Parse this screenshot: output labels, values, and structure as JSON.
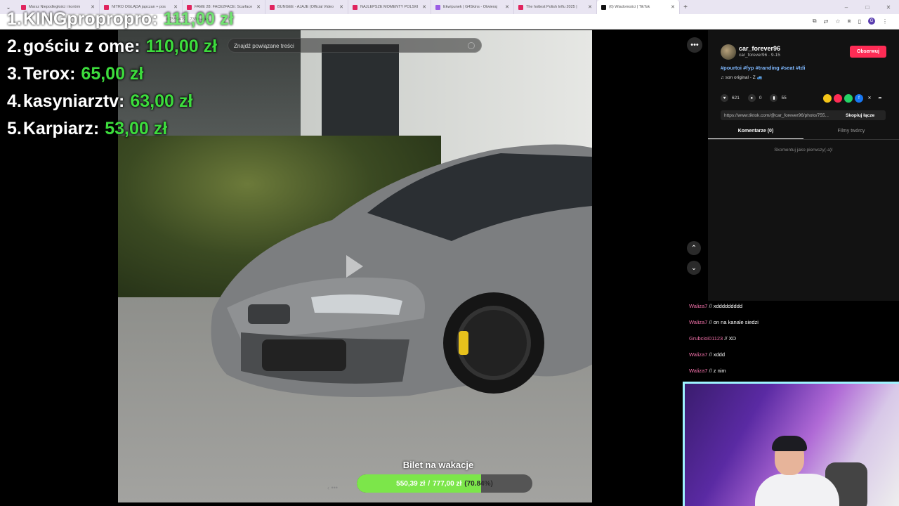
{
  "browser": {
    "tabs": [
      {
        "label": "Marsz Niepodległości i kontrm",
        "color": "#e0245e"
      },
      {
        "label": "NITRO OGLĄDA japczan + pos",
        "color": "#e0245e"
      },
      {
        "label": "FAME 28: FACE2FACE: Scarface",
        "color": "#e0245e"
      },
      {
        "label": "BUNGEE - AJAJE (Official Video",
        "color": "#e0245e"
      },
      {
        "label": "NAJLEPSZE MOMENTY POLSKI",
        "color": "#e0245e"
      },
      {
        "label": "Ekwipunek | G4Skins - Otwieraj",
        "color": "#9b5de5"
      },
      {
        "label": "The hottest Polish Influ 2025 |",
        "color": "#e0245e"
      },
      {
        "label": "(6) Wiadomości | TikTok",
        "color": "#111111"
      }
    ],
    "url_fragment": "d/7559479…73/images"
  },
  "leaderboard": [
    {
      "rank": "1.",
      "name": "KINGpropropro:",
      "amount": "111,00 zł"
    },
    {
      "rank": "2.",
      "name": "gościu z ome:",
      "amount": "110,00 zł"
    },
    {
      "rank": "3.",
      "name": "Terox:",
      "amount": "65,00 zł"
    },
    {
      "rank": "4.",
      "name": "kasyniarztv:",
      "amount": "63,00 zł"
    },
    {
      "rank": "5.",
      "name": "Karpiarz:",
      "amount": "53,00 zł"
    }
  ],
  "search": {
    "placeholder": "Znajdź powiązane treści"
  },
  "post": {
    "username": "car_forever96",
    "subline": "car_forever96 · 9-15",
    "follow_label": "Obserwuj",
    "hashtags": "#pourtoi #fyp #tranding #seat #tdi",
    "music": "♫  son original - Z 🚙",
    "likes": "621",
    "comments": "0",
    "saves": "55",
    "link": "https://www.tiktok.com/@car_forever96/photo/755...",
    "copy_label": "Skopiuj łącze",
    "tab_comments": "Komentarze (0)",
    "tab_creator": "Filmy twórcy",
    "empty_comments": "Skomentuj jako pierwszy(-a)!"
  },
  "goal": {
    "title": "Bilet na wakacje",
    "current": "550,39 zł",
    "separator": "/",
    "target": "777,00 zł",
    "percent_label": "(70.84%)",
    "fraction": 0.7084
  },
  "chat": [
    {
      "nick": "Waliza7",
      "text": "xddddddddd"
    },
    {
      "nick": "Waliza7",
      "text": "on na kanale siedzi"
    },
    {
      "nick": "Grubcioi01123",
      "text": "XD"
    },
    {
      "nick": "Waliza7",
      "text": "xddd"
    },
    {
      "nick": "Waliza7",
      "text": "z nim"
    }
  ],
  "colors": {
    "accent_green": "#3ddc3d",
    "tiktok_red": "#fe2c55",
    "goal_fill": "#7ce64a",
    "cam_border": "#9ef3ff"
  }
}
